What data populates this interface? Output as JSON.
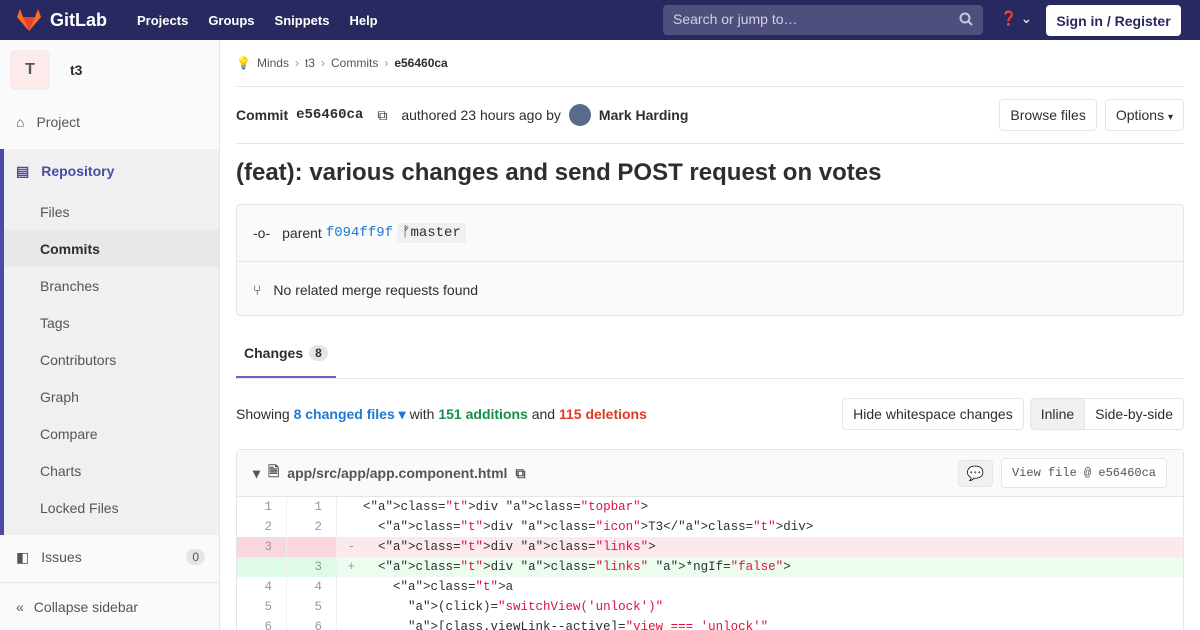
{
  "topbar": {
    "brand": "GitLab",
    "nav": [
      "Projects",
      "Groups",
      "Snippets",
      "Help"
    ],
    "search_placeholder": "Search or jump to…",
    "signin": "Sign in / Register"
  },
  "sidebar": {
    "project_initial": "T",
    "project_name": "t3",
    "project": "Project",
    "repository": "Repository",
    "subitems": [
      "Files",
      "Commits",
      "Branches",
      "Tags",
      "Contributors",
      "Graph",
      "Compare",
      "Charts",
      "Locked Files"
    ],
    "active": "Commits",
    "issues": "Issues",
    "issues_count": "0",
    "collapse": "Collapse sidebar"
  },
  "breadcrumb": [
    "Minds",
    "t3",
    "Commits",
    "e56460ca"
  ],
  "commit": {
    "label": "Commit",
    "sha": "e56460ca",
    "authored": "authored 23 hours ago by",
    "author": "Mark Harding",
    "browse": "Browse files",
    "options": "Options",
    "title": "(feat): various changes and send POST request on votes",
    "parent_label": "parent",
    "parent_sha": "f094ff9f",
    "branch": "master",
    "mr": "No related merge requests found"
  },
  "tabs": {
    "changes": "Changes",
    "changes_count": "8"
  },
  "summary": {
    "showing": "Showing",
    "files": "8 changed files",
    "with": "with",
    "additions": "151 additions",
    "and": "and",
    "deletions": "115 deletions",
    "hide_ws": "Hide whitespace changes",
    "inline": "Inline",
    "side": "Side-by-side"
  },
  "file": {
    "path": "app/src/app/app.component.html",
    "view": "View file @ e56460ca"
  },
  "diff": [
    {
      "old": "1",
      "new": "1",
      "sign": " ",
      "code": "<div class=\"topbar\">",
      "type": "ctx"
    },
    {
      "old": "2",
      "new": "2",
      "sign": " ",
      "code": "  <div class=\"icon\">T3</div>",
      "type": "ctx"
    },
    {
      "old": "3",
      "new": "",
      "sign": "-",
      "code": "  <div class=\"links\">",
      "type": "rm"
    },
    {
      "old": "",
      "new": "3",
      "sign": "+",
      "code": "  <div class=\"links\" *ngIf=\"false\">",
      "type": "ad"
    },
    {
      "old": "4",
      "new": "4",
      "sign": " ",
      "code": "    <a",
      "type": "ctx"
    },
    {
      "old": "5",
      "new": "5",
      "sign": " ",
      "code": "      (click)=\"switchView('unlock')\"",
      "type": "ctx"
    },
    {
      "old": "6",
      "new": "6",
      "sign": " ",
      "code": "      [class.viewLink--active]=\"view === 'unlock'\"",
      "type": "ctx"
    }
  ]
}
